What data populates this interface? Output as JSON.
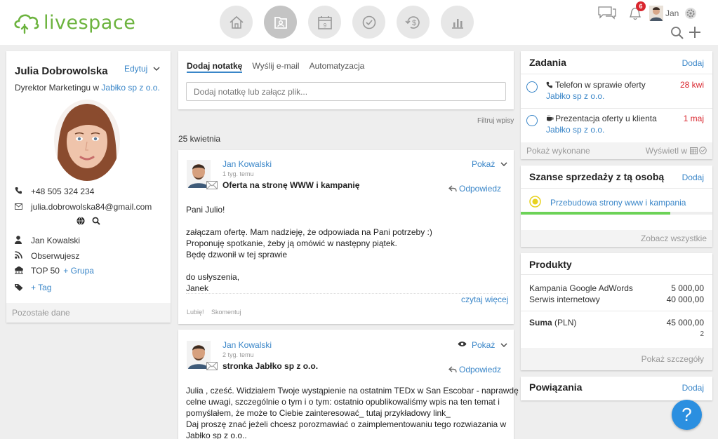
{
  "brand": {
    "name": "livespace",
    "accent": "#6cb33e",
    "link": "#3a86c8"
  },
  "nav": {
    "items": [
      {
        "icon": "home-icon"
      },
      {
        "icon": "contacts-icon",
        "active": true
      },
      {
        "icon": "calendar-icon",
        "day": "9"
      },
      {
        "icon": "tasks-check-icon"
      },
      {
        "icon": "deals-icon"
      },
      {
        "icon": "reports-icon"
      }
    ]
  },
  "topbar": {
    "notifications_count": "6",
    "user_name": "Jan"
  },
  "contact": {
    "name": "Julia Dobrowolska",
    "edit_label": "Edytuj",
    "title_prefix": "Dyrektor Marketingu w",
    "company": "Jabłko sp z o.o.",
    "phone": "+48 505 324 234",
    "email": "julia.dobrowolska84@gmail.com",
    "owner": "Jan Kowalski",
    "follow": "Obserwujesz",
    "group": "TOP 50",
    "add_group": "+ Grupa",
    "add_tag": "+ Tag",
    "more_data": "Pozostałe dane"
  },
  "composer": {
    "tabs": [
      "Dodaj notatkę",
      "Wyślij e-mail",
      "Automatyzacja"
    ],
    "placeholder": "Dodaj notatkę lub załącz plik...",
    "filter": "Filtruj wpisy"
  },
  "feed": {
    "date": "25 kwietnia",
    "post1": {
      "author": "Jan Kowalski",
      "time": "1 tyg. temu",
      "subject": "Oferta na stronę WWW i kampanię",
      "show": "Pokaż",
      "reply": "Odpowiedz",
      "lines": [
        "Pani Julio!",
        "",
        "załączam ofertę. Mam nadzieję, że odpowiada na Pani potrzeby :)",
        "Proponuję spotkanie, żeby ją omówić w następny piątek.",
        "Będę dzwonił w tej sprawie",
        "",
        "do usłyszenia,",
        "Janek"
      ],
      "read_more": "czytaj więcej",
      "like": "Lubię!",
      "comment": "Skomentuj"
    },
    "post2": {
      "author": "Jan Kowalski",
      "time": "2 tyg. temu",
      "subject": "stronka Jabłko sp z o.o.",
      "show": "Pokaż",
      "reply": "Odpowiedz",
      "lines": [
        "Julia , cześć. Widziałem Twoje wystąpienie na ostatnim TEDx w San Escobar - naprawdę",
        "celne uwagi, szczególnie o tym i o tym: ostatnio opublikowaliśmy wpis na ten temat i",
        "pomyślałem, że może to Ciebie zainteresować_ tutaj przykładowy link_",
        "Daj proszę znać jeżeli chcesz porozmawiać o zaimplementowaniu tego rozwiazania w",
        "Jabłko sp z o.o.."
      ]
    }
  },
  "tasks": {
    "title": "Zadania",
    "add": "Dodaj",
    "items": [
      {
        "icon": "phone-icon",
        "title": "Telefon w sprawie oferty",
        "company": "Jabłko sp z o.o.",
        "date": "28 kwi"
      },
      {
        "icon": "coffee-icon",
        "title": "Prezentacja oferty u klienta",
        "company": "Jabłko sp z o.o.",
        "date": "1 maj"
      }
    ],
    "show_done": "Pokaż wykonane",
    "show_in": "Wyświetl w"
  },
  "deals": {
    "title": "Szanse sprzedaży z tą osobą",
    "add": "Dodaj",
    "items": [
      {
        "name": "Przebudowa strony www i kampania",
        "progress": 0.78
      }
    ],
    "see_all": "Zobacz wszystkie"
  },
  "products": {
    "title": "Produkty",
    "items": [
      {
        "name": "Kampania Google AdWords",
        "price": "5 000,00"
      },
      {
        "name": "Serwis internetowy",
        "price": "40 000,00"
      }
    ],
    "sum_label": "Suma",
    "currency": "(PLN)",
    "sum": "45 000,00",
    "count": "2",
    "details": "Pokaż szczegóły"
  },
  "relations": {
    "title": "Powiązania",
    "add": "Dodaj"
  },
  "help": {
    "label": "?"
  }
}
